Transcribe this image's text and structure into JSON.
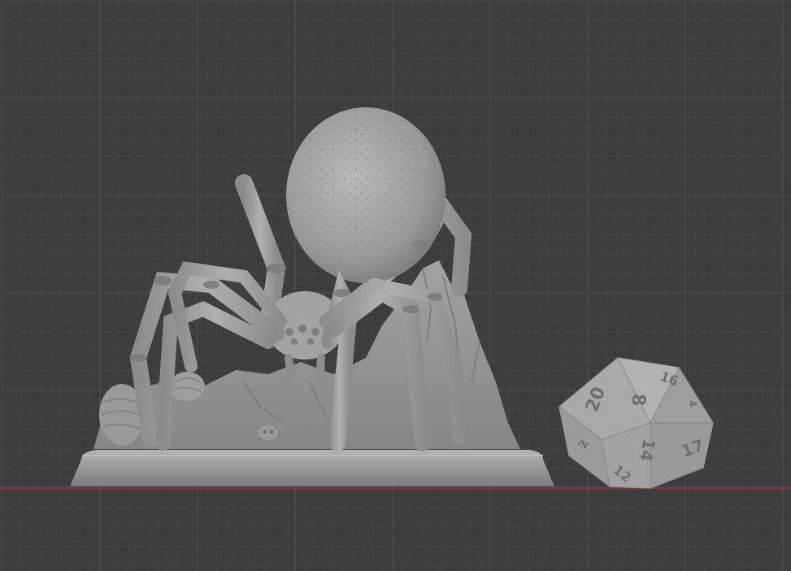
{
  "viewport": {
    "background_color": "#3d3d3d",
    "grid_minor_color": "#454545",
    "grid_major_color": "#4e4e4e",
    "ground_axis_color": "#b0343a"
  },
  "scene": {
    "objects": [
      {
        "name": "spider-miniature",
        "material_color": "#a4a4a4"
      },
      {
        "name": "round-base",
        "material_color": "#9c9c9c"
      },
      {
        "name": "d20-die",
        "material_color": "#a6a6a6"
      }
    ]
  },
  "d20": {
    "faces": [
      "20",
      "8",
      "16",
      "2",
      "14",
      "17",
      "12",
      "4"
    ]
  }
}
